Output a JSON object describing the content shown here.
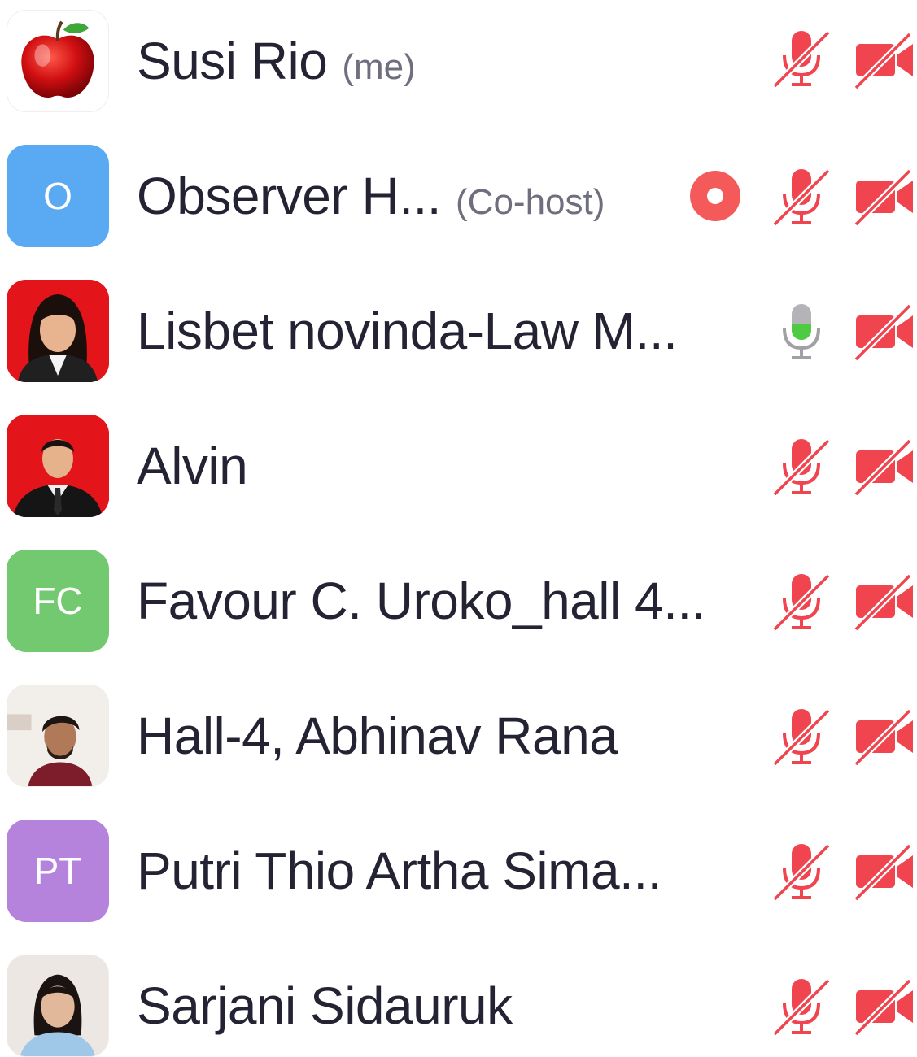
{
  "colors": {
    "muted_red": "#f0454f",
    "active_green": "#4ecb43",
    "record_red": "#f45a5a",
    "blue_avatar": "#5aaaf3",
    "green_avatar": "#73c96f",
    "purple_avatar": "#b683dc"
  },
  "participants": [
    {
      "name": "Susi Rio",
      "tag": "(me)",
      "avatar": {
        "type": "image",
        "icon": "apple-icon"
      },
      "recording": false,
      "mic": "muted",
      "video": "off"
    },
    {
      "name": "Observer  H...",
      "tag": "(Co-host)",
      "avatar": {
        "type": "initials",
        "initials": "O",
        "color": "#5aaaf3"
      },
      "recording": true,
      "mic": "muted",
      "video": "off"
    },
    {
      "name": "Lisbet novinda-Law M...",
      "tag": "",
      "avatar": {
        "type": "image",
        "icon": "profile-photo-red-bg-woman"
      },
      "recording": false,
      "mic": "active",
      "video": "off"
    },
    {
      "name": "Alvin",
      "tag": "",
      "avatar": {
        "type": "image",
        "icon": "profile-photo-red-bg-man"
      },
      "recording": false,
      "mic": "muted",
      "video": "off"
    },
    {
      "name": "Favour C. Uroko_hall 4...",
      "tag": "",
      "avatar": {
        "type": "initials",
        "initials": "FC",
        "color": "#73c96f"
      },
      "recording": false,
      "mic": "muted",
      "video": "off"
    },
    {
      "name": "Hall-4, Abhinav Rana",
      "tag": "",
      "avatar": {
        "type": "image",
        "icon": "profile-photo-light-bg-man"
      },
      "recording": false,
      "mic": "muted",
      "video": "off"
    },
    {
      "name": "Putri Thio Artha Sima...",
      "tag": "",
      "avatar": {
        "type": "initials",
        "initials": "PT",
        "color": "#b683dc"
      },
      "recording": false,
      "mic": "muted",
      "video": "off"
    },
    {
      "name": "Sarjani Sidauruk",
      "tag": "",
      "avatar": {
        "type": "image",
        "icon": "profile-photo-light-bg-woman"
      },
      "recording": false,
      "mic": "muted",
      "video": "off"
    }
  ]
}
